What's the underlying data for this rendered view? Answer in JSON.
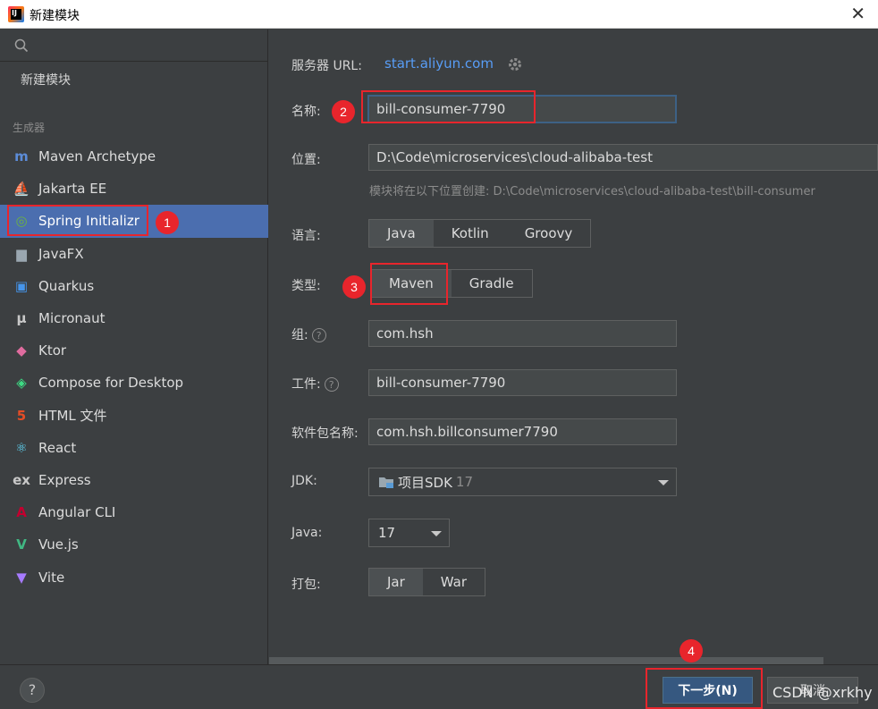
{
  "window": {
    "title": "新建模块",
    "close_glyph": "✕"
  },
  "sidebar": {
    "new_module": "新建模块",
    "section_label": "生成器",
    "items": [
      {
        "label": "Maven Archetype",
        "icon": "maven-icon",
        "glyph": "m",
        "color": "#5c8cd8"
      },
      {
        "label": "Jakarta EE",
        "icon": "jakarta-icon",
        "glyph": "⛵",
        "color": "#f0a030"
      },
      {
        "label": "Spring Initializr",
        "icon": "spring-icon",
        "glyph": "◎",
        "color": "#6db33f"
      },
      {
        "label": "JavaFX",
        "icon": "folder-icon",
        "glyph": "▆",
        "color": "#9aa7b0"
      },
      {
        "label": "Quarkus",
        "icon": "quarkus-icon",
        "glyph": "▣",
        "color": "#4695eb"
      },
      {
        "label": "Micronaut",
        "icon": "micronaut-icon",
        "glyph": "μ",
        "color": "#c8c8c8"
      },
      {
        "label": "Ktor",
        "icon": "ktor-icon",
        "glyph": "◆",
        "color": "#e06c9f"
      },
      {
        "label": "Compose for Desktop",
        "icon": "compose-icon",
        "glyph": "◈",
        "color": "#3ddc84"
      },
      {
        "label": "HTML 文件",
        "icon": "html5-icon",
        "glyph": "5",
        "color": "#e44d26"
      },
      {
        "label": "React",
        "icon": "react-icon",
        "glyph": "⚛",
        "color": "#61dafb"
      },
      {
        "label": "Express",
        "icon": "express-icon",
        "glyph": "ex",
        "color": "#c8c8c8"
      },
      {
        "label": "Angular CLI",
        "icon": "angular-icon",
        "glyph": "A",
        "color": "#c3002f"
      },
      {
        "label": "Vue.js",
        "icon": "vue-icon",
        "glyph": "V",
        "color": "#41b883"
      },
      {
        "label": "Vite",
        "icon": "vite-icon",
        "glyph": "▼",
        "color": "#a77bff"
      }
    ],
    "selected_index": 2
  },
  "form": {
    "server_label": "服务器 URL:",
    "server_url": "start.aliyun.com",
    "name_label": "名称:",
    "name_value": "bill-consumer-7790",
    "location_label": "位置:",
    "location_value": "D:\\Code\\microservices\\cloud-alibaba-test",
    "location_hint": "模块将在以下位置创建: D:\\Code\\microservices\\cloud-alibaba-test\\bill-consumer",
    "language_label": "语言:",
    "languages": [
      "Java",
      "Kotlin",
      "Groovy"
    ],
    "type_label": "类型:",
    "types": [
      "Maven",
      "Gradle"
    ],
    "group_label": "组:",
    "group_value": "com.hsh",
    "artifact_label": "工件:",
    "artifact_value": "bill-consumer-7790",
    "package_label": "软件包名称:",
    "package_value": "com.hsh.billconsumer7790",
    "jdk_label": "JDK:",
    "jdk_value": "项目SDK",
    "jdk_version": "17",
    "java_label": "Java:",
    "java_value": "17",
    "packaging_label": "打包:",
    "packagings": [
      "Jar",
      "War"
    ],
    "help_glyph": "?"
  },
  "footer": {
    "help": "?",
    "next_label": "下一步(N)",
    "cancel_label": "取消"
  },
  "annotations": [
    "1",
    "2",
    "3",
    "4"
  ],
  "watermark": "CSDN @xrkhy"
}
